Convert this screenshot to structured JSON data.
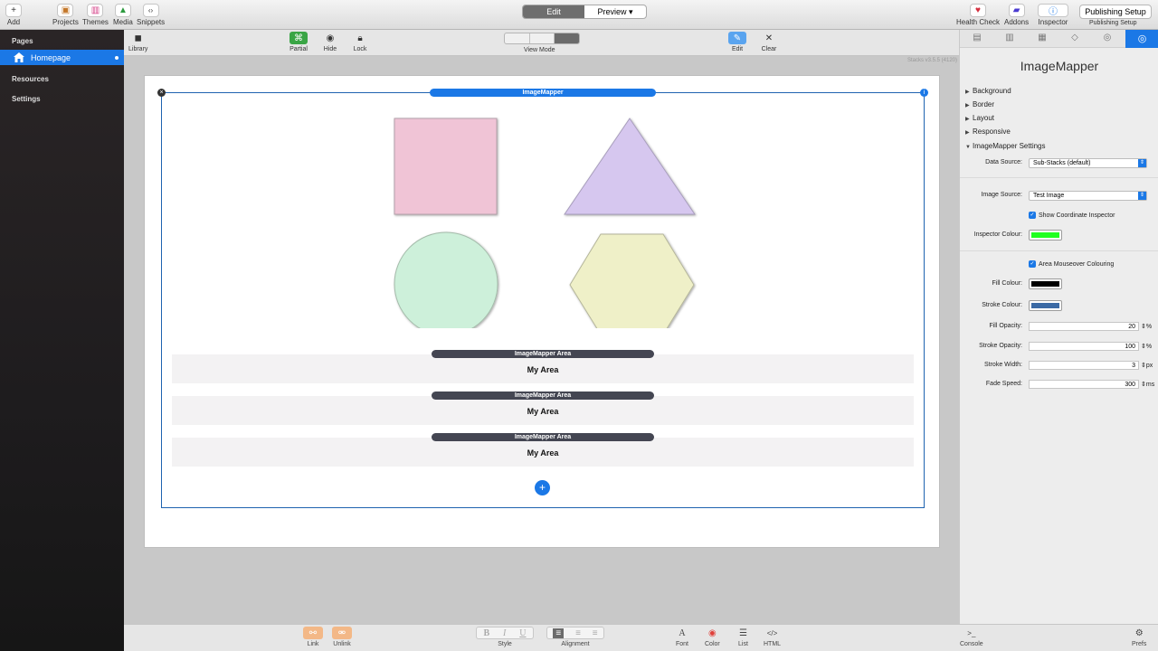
{
  "topbar": {
    "left_buttons": [
      {
        "label": "Add",
        "icon": "+"
      },
      {
        "label": "Projects",
        "icon": "▣"
      },
      {
        "label": "Themes",
        "icon": "▥"
      },
      {
        "label": "Media",
        "icon": "▲"
      },
      {
        "label": "Snippets",
        "icon": "‹›"
      }
    ],
    "mode_edit": "Edit",
    "mode_preview": "Preview ▾",
    "right_buttons": [
      {
        "label": "Health Check",
        "icon": "♥"
      },
      {
        "label": "Addons",
        "icon": "▰"
      },
      {
        "label": "Inspector",
        "icon": "ⓘ"
      }
    ],
    "publishing_button": "Publishing Setup",
    "publishing_label": "Publishing Setup"
  },
  "sidebar": {
    "pages_heading": "Pages",
    "home": "Homepage",
    "resources": "Resources",
    "settings": "Settings"
  },
  "toolbar2": {
    "library": "Library",
    "partial": "Partial",
    "hide": "Hide",
    "lock": "Lock",
    "view_mode": "View Mode",
    "edit": "Edit",
    "clear": "Clear",
    "version": "Stacks v3.5.5 (4120)"
  },
  "canvas": {
    "stack_label": "ImageMapper",
    "areas": [
      {
        "bar": "ImageMapper Area",
        "text": "My Area"
      },
      {
        "bar": "ImageMapper Area",
        "text": "My Area"
      },
      {
        "bar": "ImageMapper Area",
        "text": "My Area"
      }
    ]
  },
  "inspector": {
    "title": "ImageMapper",
    "sections": [
      "Background",
      "Border",
      "Layout",
      "Responsive",
      "ImageMapper Settings"
    ],
    "data_source_label": "Data Source:",
    "data_source_value": "Sub-Stacks (default)",
    "image_source_label": "Image Source:",
    "image_source_value": "Test Image",
    "show_coord": "Show Coordinate Inspector",
    "inspector_colour_label": "Inspector Colour:",
    "inspector_colour": "#1fff1f",
    "mouseover": "Area Mouseover Colouring",
    "fill_colour_label": "Fill Colour:",
    "fill_colour": "#000000",
    "stroke_colour_label": "Stroke Colour:",
    "stroke_colour": "#3b6aa5",
    "fill_opacity_label": "Fill Opacity:",
    "fill_opacity": "20",
    "stroke_opacity_label": "Stroke Opacity:",
    "stroke_opacity": "100",
    "stroke_width_label": "Stroke Width:",
    "stroke_width": "3",
    "fade_speed_label": "Fade Speed:",
    "fade_speed": "300",
    "unit_pct": "%",
    "unit_px": "px",
    "unit_ms": "ms"
  },
  "bottombar": {
    "link": "Link",
    "unlink": "Unlink",
    "style": "Style",
    "alignment": "Alignment",
    "font": "Font",
    "color": "Color",
    "list": "List",
    "html": "HTML",
    "console": "Console",
    "prefs": "Prefs",
    "style_b": "B",
    "style_i": "I",
    "style_u": "U"
  }
}
